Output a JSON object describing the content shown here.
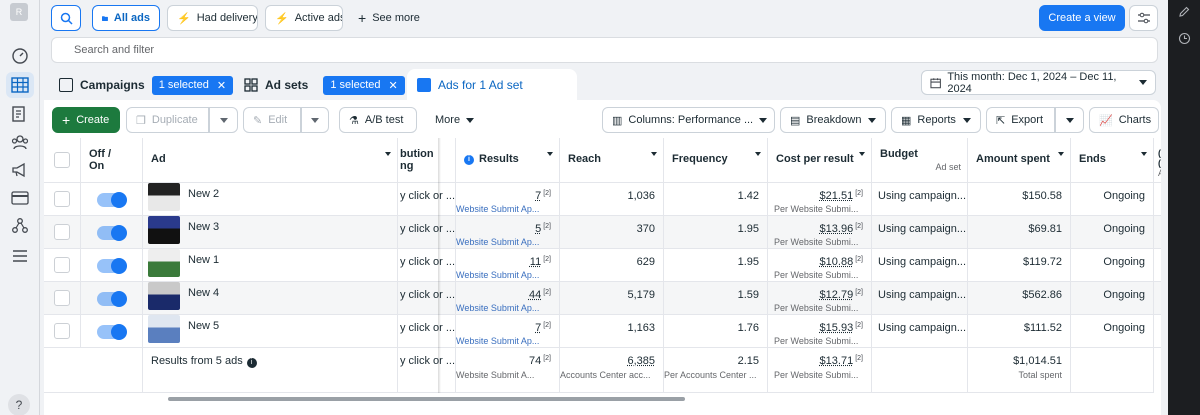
{
  "sidebar": {
    "avatar": "R",
    "help": "?"
  },
  "toolbar": {
    "all_ads": "All ads",
    "had_delivery": "Had delivery",
    "active_ads": "Active ads",
    "see_more": "See more",
    "create_view": "Create a view"
  },
  "search": {
    "placeholder": "Search and filter"
  },
  "tabs": {
    "campaigns": "Campaigns",
    "campaigns_sel": "1 selected",
    "adsets": "Ad sets",
    "adsets_sel": "1 selected",
    "ads": "Ads for 1 Ad set"
  },
  "date_range": "This month: Dec 1, 2024 – Dec 11, 2024",
  "actions": {
    "create": "Create",
    "duplicate": "Duplicate",
    "edit": "Edit",
    "ab_test": "A/B test",
    "more": "More",
    "columns": "Columns: Performance ...",
    "breakdown": "Breakdown",
    "reports": "Reports",
    "export": "Export",
    "charts": "Charts"
  },
  "headers": {
    "offon1": "Off /",
    "offon2": "On",
    "ad": "Ad",
    "attr1": "bution",
    "attr2": "ng",
    "results": "Results",
    "reach": "Reach",
    "frequency": "Frequency",
    "cpr": "Cost per result",
    "budget": "Budget",
    "budget_sub": "Ad set",
    "amount": "Amount spent",
    "ends": "Ends",
    "extra1": "(",
    "extra2": "(",
    "extra3": "A"
  },
  "rows": [
    {
      "name": "New 2",
      "attr": "y click or ...",
      "results": "7",
      "results_sub": "Website Submit Ap...",
      "reach": "1,036",
      "frequency": "1.42",
      "cpr": "$21.51",
      "cpr_sub": "Per Website Submi...",
      "budget": "Using campaign...",
      "amount": "$150.58",
      "ends": "Ongoing"
    },
    {
      "name": "New 3",
      "attr": "y click or ...",
      "results": "5",
      "results_sub": "Website Submit Ap...",
      "reach": "370",
      "frequency": "1.95",
      "cpr": "$13.96",
      "cpr_sub": "Per Website Submi...",
      "budget": "Using campaign...",
      "amount": "$69.81",
      "ends": "Ongoing"
    },
    {
      "name": "New 1",
      "attr": "y click or ...",
      "results": "11",
      "results_sub": "Website Submit Ap...",
      "reach": "629",
      "frequency": "1.95",
      "cpr": "$10.88",
      "cpr_sub": "Per Website Submi...",
      "budget": "Using campaign...",
      "amount": "$119.72",
      "ends": "Ongoing"
    },
    {
      "name": "New 4",
      "attr": "y click or ...",
      "results": "44",
      "results_sub": "Website Submit Ap...",
      "reach": "5,179",
      "frequency": "1.59",
      "cpr": "$12.79",
      "cpr_sub": "Per Website Submi...",
      "budget": "Using campaign...",
      "amount": "$562.86",
      "ends": "Ongoing"
    },
    {
      "name": "New 5",
      "attr": "y click or ...",
      "results": "7",
      "results_sub": "Website Submit Ap...",
      "reach": "1,163",
      "frequency": "1.76",
      "cpr": "$15.93",
      "cpr_sub": "Per Website Submi...",
      "budget": "Using campaign...",
      "amount": "$111.52",
      "ends": "Ongoing"
    }
  ],
  "sup": "[2]",
  "summary": {
    "label": "Results from 5 ads",
    "attr": "y click or ...",
    "results": "74",
    "results_sub": "Website Submit A...",
    "reach": "6,385",
    "reach_sub": "Accounts Center acc...",
    "frequency": "2.15",
    "frequency_sub": "Per Accounts Center ...",
    "cpr": "$13.71",
    "cpr_sub": "Per Website Submi...",
    "amount": "$1,014.51",
    "amount_sub": "Total spent"
  },
  "colors": {
    "accent": "#1877f2",
    "create_green": "#1d7a3e",
    "right_nav": "#1c1e21"
  }
}
